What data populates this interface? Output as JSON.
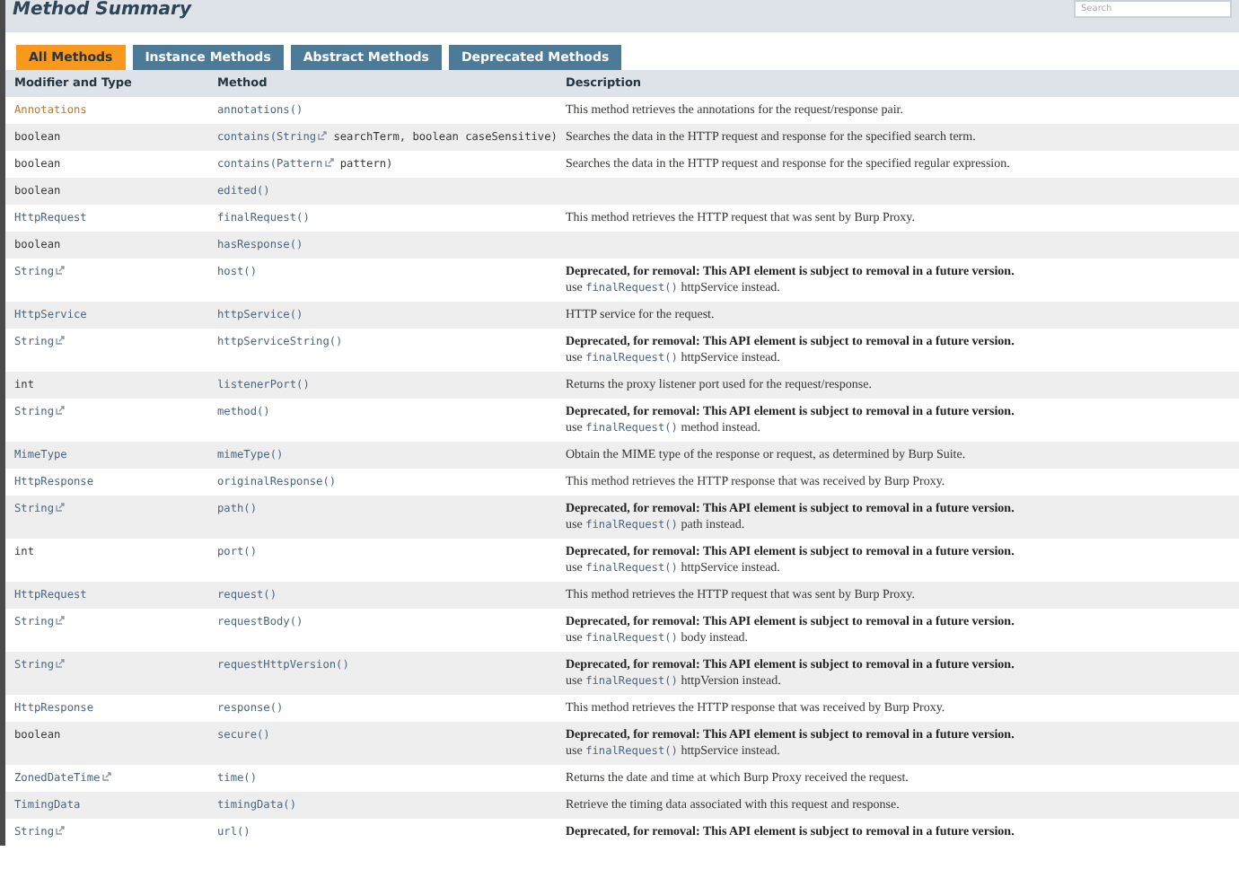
{
  "title": "Method Summary",
  "search": {
    "placeholder": "Search"
  },
  "tabs": [
    {
      "label": "All Methods",
      "selected": true
    },
    {
      "label": "Instance Methods",
      "selected": false
    },
    {
      "label": "Abstract Methods",
      "selected": false
    },
    {
      "label": "Deprecated Methods",
      "selected": false
    }
  ],
  "columns": [
    "Modifier and Type",
    "Method",
    "Description"
  ],
  "rows": [
    {
      "type": {
        "text": "Annotations",
        "kind": "hover",
        "external": false
      },
      "method": {
        "link": "annotations()"
      },
      "description": {
        "kind": "text",
        "text": "This method retrieves the annotations for the request/response pair."
      }
    },
    {
      "type": {
        "text": "boolean",
        "kind": "plain",
        "external": false
      },
      "method": {
        "link": "contains(String",
        "external": true,
        "rest": " searchTerm, boolean caseSensitive)"
      },
      "description": {
        "kind": "text",
        "text": "Searches the data in the HTTP request and response for the specified search term."
      }
    },
    {
      "type": {
        "text": "boolean",
        "kind": "plain",
        "external": false
      },
      "method": {
        "link": "contains(Pattern",
        "external": true,
        "rest": " pattern)"
      },
      "description": {
        "kind": "text",
        "text": "Searches the data in the HTTP request and response for the specified regular expression."
      }
    },
    {
      "type": {
        "text": "boolean",
        "kind": "plain",
        "external": false
      },
      "method": {
        "link": "edited()"
      },
      "description": {
        "kind": "none"
      }
    },
    {
      "type": {
        "text": "HttpRequest",
        "kind": "link",
        "external": false
      },
      "method": {
        "link": "finalRequest()"
      },
      "description": {
        "kind": "text",
        "text": "This method retrieves the HTTP request that was sent by Burp Proxy."
      }
    },
    {
      "type": {
        "text": "boolean",
        "kind": "plain",
        "external": false
      },
      "method": {
        "link": "hasResponse()"
      },
      "description": {
        "kind": "none"
      }
    },
    {
      "type": {
        "text": "String",
        "kind": "link",
        "external": true
      },
      "method": {
        "link": "host()"
      },
      "description": {
        "kind": "deprecated",
        "text": "Deprecated, for removal: This API element is subject to removal in a future version.",
        "note_prefix": "use",
        "note_link": "finalRequest()",
        "note_rest": "httpService instead."
      }
    },
    {
      "type": {
        "text": "HttpService",
        "kind": "link",
        "external": false
      },
      "method": {
        "link": "httpService()"
      },
      "description": {
        "kind": "text",
        "text": "HTTP service for the request."
      }
    },
    {
      "type": {
        "text": "String",
        "kind": "link",
        "external": true
      },
      "method": {
        "link": "httpServiceString()"
      },
      "description": {
        "kind": "deprecated",
        "text": "Deprecated, for removal: This API element is subject to removal in a future version.",
        "note_prefix": "use",
        "note_link": "finalRequest()",
        "note_rest": "httpService instead."
      }
    },
    {
      "type": {
        "text": "int",
        "kind": "plain",
        "external": false
      },
      "method": {
        "link": "listenerPort()"
      },
      "description": {
        "kind": "text",
        "text": "Returns the proxy listener port used for the request/response."
      }
    },
    {
      "type": {
        "text": "String",
        "kind": "link",
        "external": true
      },
      "method": {
        "link": "method()"
      },
      "description": {
        "kind": "deprecated",
        "text": "Deprecated, for removal: This API element is subject to removal in a future version.",
        "note_prefix": "use",
        "note_link": "finalRequest()",
        "note_rest": "method instead."
      }
    },
    {
      "type": {
        "text": "MimeType",
        "kind": "link",
        "external": false
      },
      "method": {
        "link": "mimeType()"
      },
      "description": {
        "kind": "text",
        "text": "Obtain the MIME type of the response or request, as determined by Burp Suite."
      }
    },
    {
      "type": {
        "text": "HttpResponse",
        "kind": "link",
        "external": false
      },
      "method": {
        "link": "originalResponse()"
      },
      "description": {
        "kind": "text",
        "text": "This method retrieves the HTTP response that was received by Burp Proxy."
      }
    },
    {
      "type": {
        "text": "String",
        "kind": "link",
        "external": true
      },
      "method": {
        "link": "path()"
      },
      "description": {
        "kind": "deprecated",
        "text": "Deprecated, for removal: This API element is subject to removal in a future version.",
        "note_prefix": "use",
        "note_link": "finalRequest()",
        "note_rest": "path instead."
      }
    },
    {
      "type": {
        "text": "int",
        "kind": "plain",
        "external": false
      },
      "method": {
        "link": "port()"
      },
      "description": {
        "kind": "deprecated",
        "text": "Deprecated, for removal: This API element is subject to removal in a future version.",
        "note_prefix": "use",
        "note_link": "finalRequest()",
        "note_rest": "httpService instead."
      }
    },
    {
      "type": {
        "text": "HttpRequest",
        "kind": "link",
        "external": false
      },
      "method": {
        "link": "request()"
      },
      "description": {
        "kind": "text",
        "text": "This method retrieves the HTTP request that was sent by Burp Proxy."
      }
    },
    {
      "type": {
        "text": "String",
        "kind": "link",
        "external": true
      },
      "method": {
        "link": "requestBody()"
      },
      "description": {
        "kind": "deprecated",
        "text": "Deprecated, for removal: This API element is subject to removal in a future version.",
        "note_prefix": "use",
        "note_link": "finalRequest()",
        "note_rest": "body instead."
      }
    },
    {
      "type": {
        "text": "String",
        "kind": "link",
        "external": true
      },
      "method": {
        "link": "requestHttpVersion()"
      },
      "description": {
        "kind": "deprecated",
        "text": "Deprecated, for removal: This API element is subject to removal in a future version.",
        "note_prefix": "use",
        "note_link": "finalRequest()",
        "note_rest": "httpVersion instead."
      }
    },
    {
      "type": {
        "text": "HttpResponse",
        "kind": "link",
        "external": false
      },
      "method": {
        "link": "response()"
      },
      "description": {
        "kind": "text",
        "text": "This method retrieves the HTTP response that was received by Burp Proxy."
      }
    },
    {
      "type": {
        "text": "boolean",
        "kind": "plain",
        "external": false
      },
      "method": {
        "link": "secure()"
      },
      "description": {
        "kind": "deprecated",
        "text": "Deprecated, for removal: This API element is subject to removal in a future version.",
        "note_prefix": "use",
        "note_link": "finalRequest()",
        "note_rest": "httpService instead."
      }
    },
    {
      "type": {
        "text": "ZonedDateTime",
        "kind": "link",
        "external": true
      },
      "method": {
        "link": "time()"
      },
      "description": {
        "kind": "text",
        "text": "Returns the date and time at which Burp Proxy received the request."
      }
    },
    {
      "type": {
        "text": "TimingData",
        "kind": "link",
        "external": false
      },
      "method": {
        "link": "timingData()"
      },
      "description": {
        "kind": "text",
        "text": "Retrieve the timing data associated with this request and response."
      }
    },
    {
      "type": {
        "text": "String",
        "kind": "link",
        "external": true
      },
      "method": {
        "link": "url()"
      },
      "description": {
        "kind": "deprecated",
        "text": "Deprecated, for removal: This API element is subject to removal in a future version."
      }
    }
  ]
}
